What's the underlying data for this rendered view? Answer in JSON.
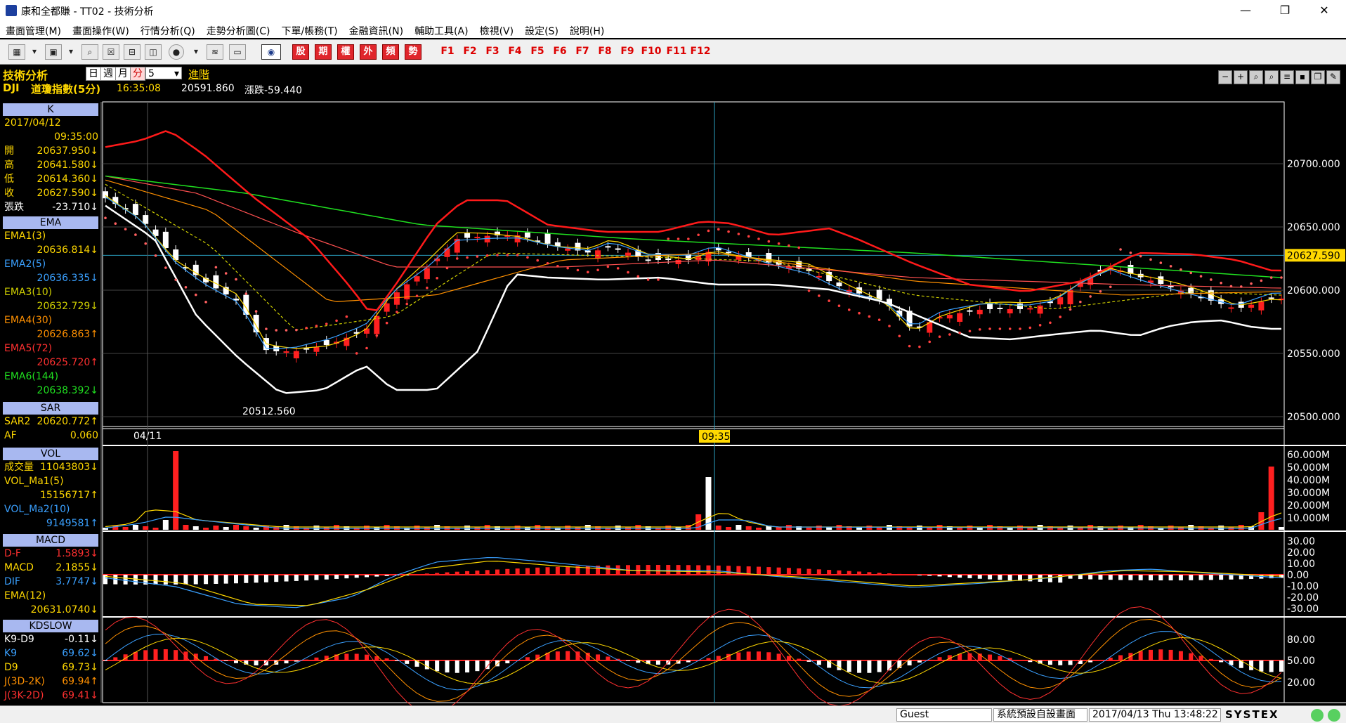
{
  "window": {
    "title": "康和全都賺 - TT02 - 技術分析",
    "min": "—",
    "max": "❐",
    "close": "✕"
  },
  "menu": [
    "畫面管理(M)",
    "畫面操作(W)",
    "行情分析(Q)",
    "走勢分析圖(C)",
    "下單/帳務(T)",
    "金融資訊(N)",
    "輔助工具(A)",
    "檢視(V)",
    "設定(S)",
    "說明(H)"
  ],
  "toolbar": {
    "quote_buttons": [
      "股",
      "期",
      "權",
      "外",
      "頻",
      "勢"
    ],
    "fkeys": [
      "F1",
      "F2",
      "F3",
      "F4",
      "F5",
      "F6",
      "F7",
      "F8",
      "F9",
      "F10",
      "F11",
      "F12"
    ]
  },
  "info": {
    "title": "技術分析",
    "periods": [
      "日",
      "週",
      "月",
      "分"
    ],
    "active_period": "分",
    "interval": "5",
    "advanced": "進階",
    "symbol": "DJI",
    "symbol_name": "道瓊指數(5分)",
    "time": "16:35:08",
    "price": "20591.860",
    "change": "漲跌-59.440"
  },
  "panel_k": {
    "header": "K",
    "date": "2017/04/12",
    "time": "09:35:00",
    "rows": [
      {
        "label": "開",
        "value": "20637.950↓",
        "color": "#ffd800"
      },
      {
        "label": "高",
        "value": "20641.580↓",
        "color": "#ffd800"
      },
      {
        "label": "低",
        "value": "20614.360↓",
        "color": "#ffd800"
      },
      {
        "label": "收",
        "value": "20627.590↓",
        "color": "#ffd800"
      },
      {
        "label": "張跌",
        "value": "-23.710↓",
        "color": "#ffffff"
      }
    ]
  },
  "panel_ema": {
    "header": "EMA",
    "rows": [
      {
        "label": "EMA1(3)",
        "value": "20636.814↓",
        "color": "#ffd800"
      },
      {
        "label": "EMA2(5)",
        "value": "20636.335↓",
        "color": "#3aa0ff"
      },
      {
        "label": "EMA3(10)",
        "value": "20632.729↓",
        "color": "#d0d000"
      },
      {
        "label": "EMA4(30)",
        "value": "20626.863↑",
        "color": "#ff9000"
      },
      {
        "label": "EMA5(72)",
        "value": "20625.720↑",
        "color": "#ff3030"
      },
      {
        "label": "EMA6(144)",
        "value": "20638.392↓",
        "color": "#20e020"
      }
    ]
  },
  "panel_sar": {
    "header": "SAR",
    "rows": [
      {
        "label": "SAR2",
        "value": "20620.772↑",
        "color": "#ffd800"
      },
      {
        "label": "AF",
        "value": "0.060",
        "color": "#ffd800"
      }
    ]
  },
  "panel_vol": {
    "header": "VOL",
    "rows": [
      {
        "label": "成交量",
        "value": "11043803↓",
        "color": "#ffd800"
      },
      {
        "label": "VOL_Ma1(5)",
        "value": "",
        "color": "#ffd800"
      },
      {
        "label": "",
        "value": "15156717↑",
        "color": "#ffd800"
      },
      {
        "label": "VOL_Ma2(10)",
        "value": "",
        "color": "#3aa0ff"
      },
      {
        "label": "",
        "value": "9149581↑",
        "color": "#3aa0ff"
      }
    ]
  },
  "panel_macd": {
    "header": "MACD",
    "rows": [
      {
        "label": "D-F",
        "value": "1.5893↓",
        "color": "#ff3030"
      },
      {
        "label": "MACD",
        "value": "2.1855↓",
        "color": "#ffd800"
      },
      {
        "label": "DIF",
        "value": "3.7747↓",
        "color": "#3aa0ff"
      },
      {
        "label": "EMA(12)",
        "value": "",
        "color": "#ffd800"
      },
      {
        "label": "",
        "value": "20631.0740↓",
        "color": "#ffd800"
      }
    ]
  },
  "panel_kd": {
    "header": "KDSLOW",
    "rows": [
      {
        "label": "K9-D9",
        "value": "-0.11↓",
        "color": "#ffffff"
      },
      {
        "label": "K9",
        "value": "69.62↓",
        "color": "#3aa0ff"
      },
      {
        "label": "D9",
        "value": "69.73↓",
        "color": "#ffd800"
      },
      {
        "label": "J(3D-2K)",
        "value": "69.94↑",
        "color": "#ff9000"
      },
      {
        "label": "J(3K-2D)",
        "value": "69.41↓",
        "color": "#ff3030"
      }
    ]
  },
  "axes": {
    "price_ticks": [
      "20700.000",
      "20650.000",
      "20600.000",
      "20550.000",
      "20500.000"
    ],
    "current_price": "20627.590",
    "vol_ticks": [
      "60.000M",
      "50.000M",
      "40.000M",
      "30.000M",
      "20.000M",
      "10.000M"
    ],
    "macd_ticks": [
      "30.00",
      "20.00",
      "10.00",
      "0.00",
      "-10.00",
      "-20.00",
      "-30.00"
    ],
    "kd_ticks": [
      "80.00",
      "50.00",
      "20.00"
    ],
    "date_label": "04/11",
    "cursor_time": "09:35",
    "low_label": "20512.560"
  },
  "status": {
    "user": "Guest",
    "layout": "系統預設自設畫面",
    "datetime": "2017/04/13 Thu 13:48:22",
    "brand": "SYSTEX"
  }
}
